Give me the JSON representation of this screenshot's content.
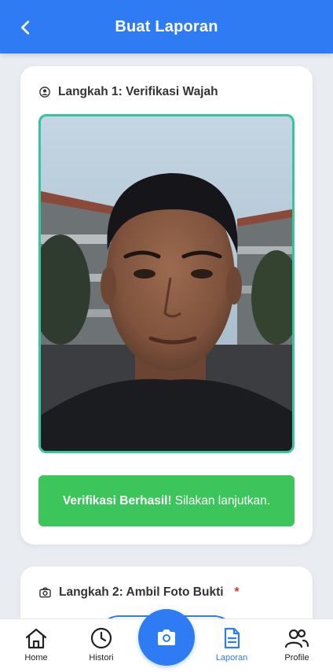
{
  "header": {
    "title": "Buat Laporan",
    "back_icon": "chevron-left-icon"
  },
  "step1": {
    "icon": "user-circle-icon",
    "title": "Langkah 1: Verifikasi Wajah",
    "photo_description": "selfie-photo",
    "status_bold": "Verifikasi Berhasil!",
    "status_text": "Silakan lanjutkan.",
    "status_color": "#3cc55a",
    "frame_color": "#35c79a"
  },
  "step2": {
    "icon": "camera-icon",
    "title": "Langkah 2: Ambil Foto Bukti",
    "required_mark": "*"
  },
  "nav": {
    "items": [
      {
        "label": "Home",
        "icon": "home-icon"
      },
      {
        "label": "Histori",
        "icon": "clock-icon"
      },
      {
        "label": "Laporan",
        "icon": "document-icon",
        "active": true
      },
      {
        "label": "Profile",
        "icon": "users-icon"
      }
    ],
    "center_icon": "camera-icon"
  },
  "colors": {
    "primary": "#2f7bf3",
    "background": "#e9edf2"
  }
}
